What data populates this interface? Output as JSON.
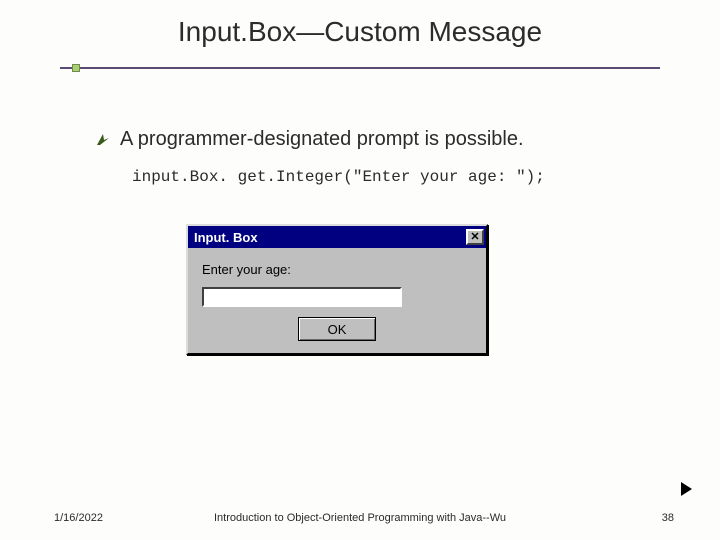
{
  "slide": {
    "title": "Input.Box—Custom Message",
    "bullet": "A programmer-designated prompt is possible.",
    "code": "input.Box. get.Integer(\"Enter your age: \");"
  },
  "dialog": {
    "title": "Input. Box",
    "close_glyph": "✕",
    "prompt": "Enter your age:",
    "input_value": "",
    "ok_label": "OK"
  },
  "footer": {
    "date": "1/16/2022",
    "course": "Introduction to Object-Oriented Programming with Java--Wu",
    "page": "38"
  }
}
